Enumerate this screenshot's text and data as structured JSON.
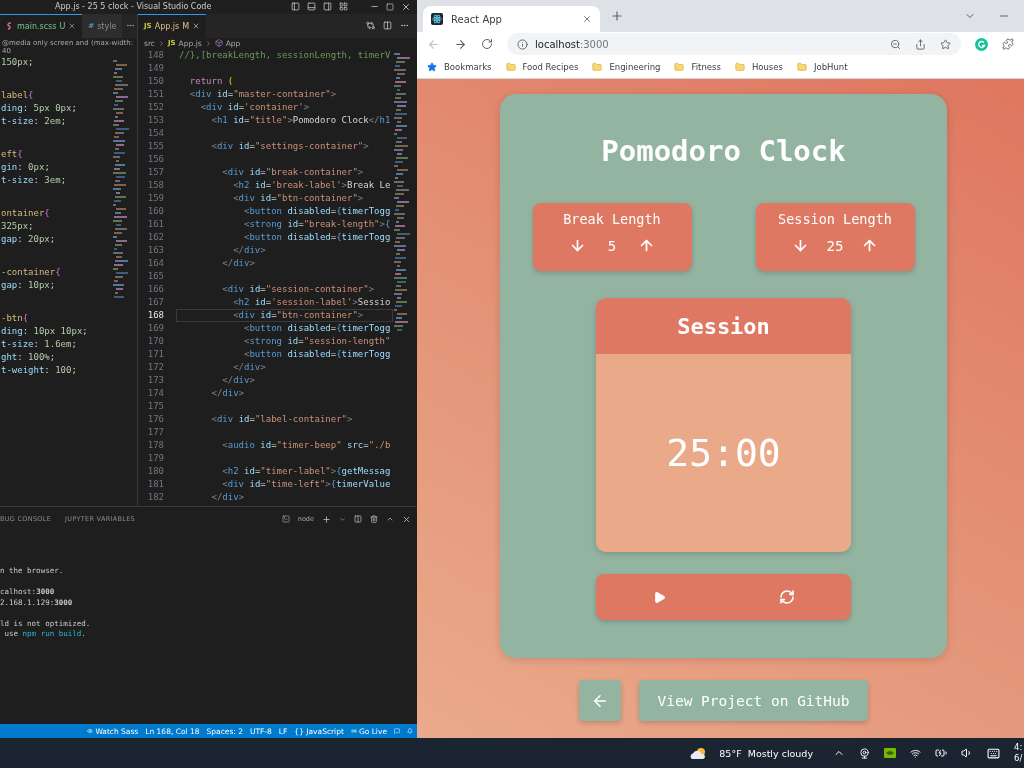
{
  "vscode": {
    "title": "App.js - 25 5 clock - Visual Studio Code",
    "left_group": {
      "tabs": [
        {
          "label": "main.scss",
          "badge": "U",
          "selected": true
        },
        {
          "glyph": "#",
          "label": "style",
          "selected": false
        }
      ],
      "breadcrumb": "@media only screen and (max-width: 40",
      "blocks": [
        [
          "150px;"
        ],
        [
          "label{",
          "ding: 5px 0px;",
          "t-size: 2em;"
        ],
        [
          "eft{",
          "gin: 0px;",
          "t-size: 3em;"
        ],
        [
          "ontainer{",
          "325px;",
          "gap: 20px;"
        ],
        [
          "-container{",
          "gap: 10px;"
        ],
        [
          "-btn{",
          "ding: 10px 10px;",
          "t-size: 1.6em;",
          "ght: 100%;",
          "t-weight: 100;"
        ]
      ]
    },
    "right_group": {
      "tab": {
        "icon": "JS",
        "label": "App.js",
        "badge": "M"
      },
      "breadcrumb": [
        {
          "label": "src"
        },
        {
          "icon": "JS",
          "label": "App.js"
        },
        {
          "label": "App"
        }
      ],
      "lines": [
        {
          "number": "148",
          "text": "//},[breakLength, sessionLength, timerV",
          "current": false
        },
        {
          "number": "149",
          "current": false
        },
        {
          "number": "150",
          "text": "  return (",
          "current": false
        },
        {
          "number": "151",
          "text": "  <div id=\"master-container\">",
          "current": false
        },
        {
          "number": "152",
          "text": "    <div id='container'>",
          "current": false
        },
        {
          "number": "153",
          "text": "      <h1 id=\"title\">Pomodoro Clock</h1",
          "current": false
        },
        {
          "number": "154",
          "current": false
        },
        {
          "number": "155",
          "text": "      <div id=\"settings-container\">",
          "current": false
        },
        {
          "number": "156",
          "current": false
        },
        {
          "number": "157",
          "text": "        <div id=\"break-container\">",
          "current": false
        },
        {
          "number": "158",
          "text": "          <h2 id='break-label'>Break Le",
          "current": false
        },
        {
          "number": "159",
          "text": "          <div id=\"btn-container\">",
          "current": false
        },
        {
          "number": "160",
          "text": "            <button disabled={timerTogg",
          "current": false
        },
        {
          "number": "161",
          "text": "            <strong id=\"break-length\">{",
          "current": false
        },
        {
          "number": "162",
          "text": "            <button disabled={timerTogg",
          "current": false
        },
        {
          "number": "163",
          "text": "          </div>",
          "current": false
        },
        {
          "number": "164",
          "text": "        </div>",
          "current": false
        },
        {
          "number": "165",
          "current": false
        },
        {
          "number": "166",
          "text": "        <div id=\"session-container\">",
          "current": false
        },
        {
          "number": "167",
          "text": "          <h2 id='session-label'>Sessio",
          "current": false
        },
        {
          "number": "168",
          "text": "          <div id=\"btn-container\">",
          "current": true
        },
        {
          "number": "169",
          "text": "            <button disabled={timerTogg",
          "current": false
        },
        {
          "number": "170",
          "text": "            <strong id=\"session-length\"",
          "current": false
        },
        {
          "number": "171",
          "text": "            <button disabled={timerTogg",
          "current": false
        },
        {
          "number": "172",
          "text": "          </div>",
          "current": false
        },
        {
          "number": "173",
          "text": "        </div>",
          "current": false
        },
        {
          "number": "174",
          "text": "      </div>",
          "current": false
        },
        {
          "number": "175",
          "current": false
        },
        {
          "number": "176",
          "text": "      <div id=\"label-container\">",
          "current": false
        },
        {
          "number": "177",
          "current": false
        },
        {
          "number": "178",
          "text": "        <audio id=\"timer-beep\" src=\"./b",
          "current": false
        },
        {
          "number": "179",
          "current": false
        },
        {
          "number": "180",
          "text": "        <h2 id=\"timer-label\">{getMessag",
          "current": false
        },
        {
          "number": "181",
          "text": "        <div id=\"time-left\">{timerValue",
          "current": false
        },
        {
          "number": "182",
          "text": "      </div>",
          "current": false
        }
      ]
    },
    "panel": {
      "tabs": [
        "BUG CONSOLE",
        "JUPYTER VARIABLES"
      ],
      "terminal_name": "node",
      "blocks": [
        [
          {
            "text": "n the browser."
          }
        ],
        [
          {
            "text": "calhost:**3000**"
          },
          {
            "text": "2.168.1.129:**3000**"
          }
        ],
        [
          {
            "text": "ld is not optimized."
          },
          {
            "text": " use ",
            "command": "npm run build",
            "rest": "."
          }
        ]
      ]
    },
    "status_bar": [
      {
        "kind": "eye",
        "label": "Watch Sass"
      },
      {
        "label": "Ln 168, Col 18"
      },
      {
        "label": "Spaces: 2"
      },
      {
        "label": "UTF-8"
      },
      {
        "label": "LF"
      },
      {
        "label": "{} JavaScript"
      },
      {
        "kind": "broadcast",
        "label": "Go Live"
      }
    ]
  },
  "browser": {
    "tab": {
      "title": "React App"
    },
    "address": {
      "host": "localhost",
      "port": ":3000"
    },
    "bookmarks": [
      {
        "kind": "star",
        "label": "Bookmarks"
      },
      {
        "kind": "folder",
        "label": "Food Recipes"
      },
      {
        "kind": "folder",
        "label": "Engineering"
      },
      {
        "kind": "folder",
        "label": "Fitness"
      },
      {
        "kind": "folder",
        "label": "Houses"
      },
      {
        "kind": "folder",
        "label": "JobHunt"
      }
    ],
    "page": {
      "title": "Pomodoro Clock",
      "settings": [
        {
          "label": "Break Length",
          "value": "5"
        },
        {
          "label": "Session Length",
          "value": "25"
        }
      ],
      "timer": {
        "label": "Session",
        "time": "25:00"
      },
      "github_button": "View Project on GitHub"
    }
  },
  "taskbar": {
    "weather": {
      "temperature": "85°F",
      "condition": "Mostly cloudy"
    },
    "clock": {
      "time": "4:",
      "date": "6/"
    }
  }
}
